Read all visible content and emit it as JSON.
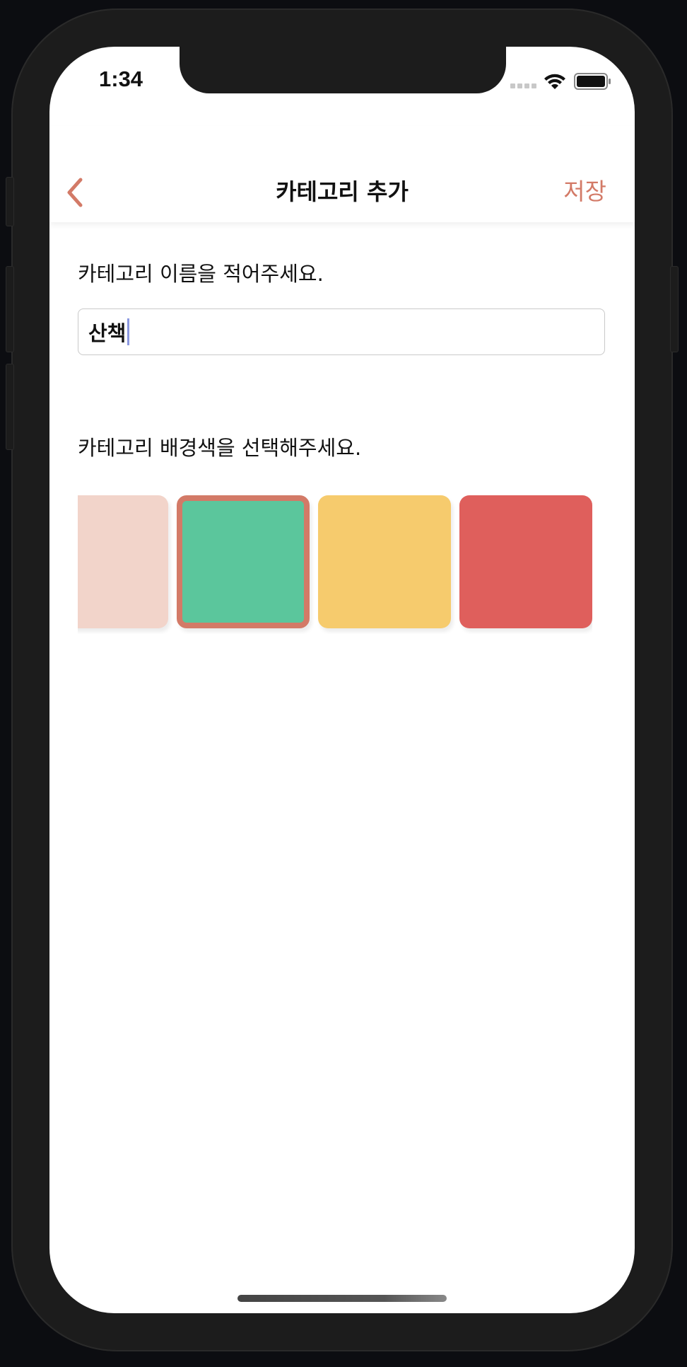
{
  "status_bar": {
    "time": "1:34"
  },
  "nav": {
    "title": "카테고리 추가",
    "save_label": "저장"
  },
  "form": {
    "name_label": "카테고리 이름을 적어주세요.",
    "name_value": "산책",
    "color_label": "카테고리 배경색을 선택해주세요."
  },
  "colors": {
    "accent": "#D37A67",
    "swatches": [
      "#F2D4CA",
      "#5BC69C",
      "#F6CB6D",
      "#DF5F5C"
    ],
    "selected_index": 1
  }
}
